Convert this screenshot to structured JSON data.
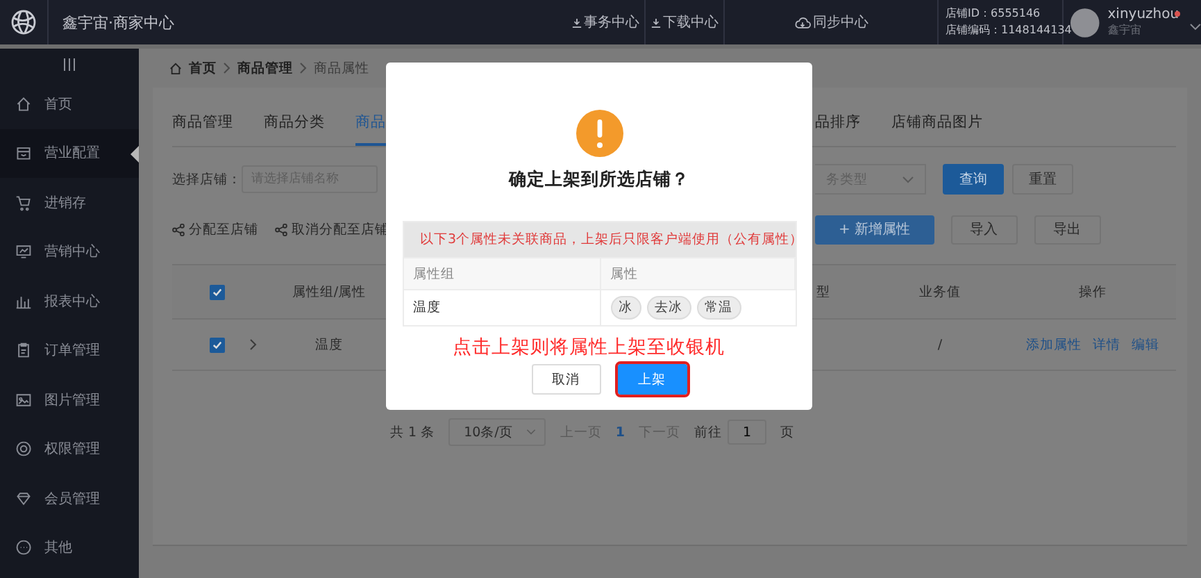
{
  "topbar": {
    "title": "鑫宇宙·商家中心",
    "links": [
      {
        "label": "事务中心"
      },
      {
        "label": "下载中心"
      },
      {
        "label": "同步中心"
      }
    ],
    "store_id": "店铺ID：6555146",
    "store_code": "店铺编码：1148144134",
    "user": {
      "name": "xinyuzhou",
      "subtitle": "鑫宇宙",
      "notification": true
    }
  },
  "sidebar": {
    "items": [
      {
        "label": "首页",
        "selected": false
      },
      {
        "label": "营业配置",
        "selected": true
      },
      {
        "label": "进销存",
        "selected": false
      },
      {
        "label": "营销中心",
        "selected": false
      },
      {
        "label": "报表中心",
        "selected": false
      },
      {
        "label": "订单管理",
        "selected": false
      },
      {
        "label": "图片管理",
        "selected": false
      },
      {
        "label": "权限管理",
        "selected": false
      },
      {
        "label": "会员管理",
        "selected": false
      },
      {
        "label": "其他",
        "selected": false
      }
    ]
  },
  "breadcrumb": [
    "首页",
    "商品管理",
    "商品属性"
  ],
  "tabs": [
    {
      "label": "商品管理",
      "selected": false
    },
    {
      "label": "商品分类",
      "selected": false
    },
    {
      "label": "商品",
      "selected": true
    },
    {
      "label": "品排序",
      "selected": false
    },
    {
      "label": "店铺商品图片",
      "selected": false
    }
  ],
  "filters": {
    "store_label": "选择店铺：",
    "store_placeholder": "请选择店铺名称",
    "type_placeholder": "务类型",
    "buttons": [
      "查询",
      "重置"
    ]
  },
  "actions": {
    "left": [
      "分配至店铺",
      "取消分配至店铺"
    ],
    "right": [
      "+ 新增属性",
      "导入",
      "导出"
    ]
  },
  "table": {
    "header_checked": true,
    "columns": [
      "属性组/属性",
      "型",
      "业务值",
      "操作"
    ],
    "rows": [
      {
        "checked": true,
        "expanded": false,
        "group": "温度",
        "value": "/",
        "links": [
          "添加属性",
          "详情",
          "编辑"
        ]
      }
    ]
  },
  "pagination": {
    "total": "共 1 条",
    "page_size": "10条/页",
    "prev": "上一页",
    "pages": [
      {
        "label": "1",
        "selected": true
      }
    ],
    "next": "下一页",
    "goto_label": "前往",
    "goto_value": "1",
    "goto_suffix": "页"
  },
  "dialog": {
    "title": "确定上架到所选店铺？",
    "notice": "以下3个属性未关联商品，上架后只限客户端使用（公有属性）",
    "columns": [
      "属性组",
      "属性"
    ],
    "rows": [
      {
        "group": "温度",
        "tags": [
          "冰",
          "去冰",
          "常温"
        ]
      }
    ],
    "annotation": "点击上架则将属性上架至收银机",
    "buttons": [
      {
        "label": "取消",
        "kind": "secondary",
        "highlighted": false
      },
      {
        "label": "上架",
        "kind": "primary",
        "highlighted": true
      }
    ]
  }
}
